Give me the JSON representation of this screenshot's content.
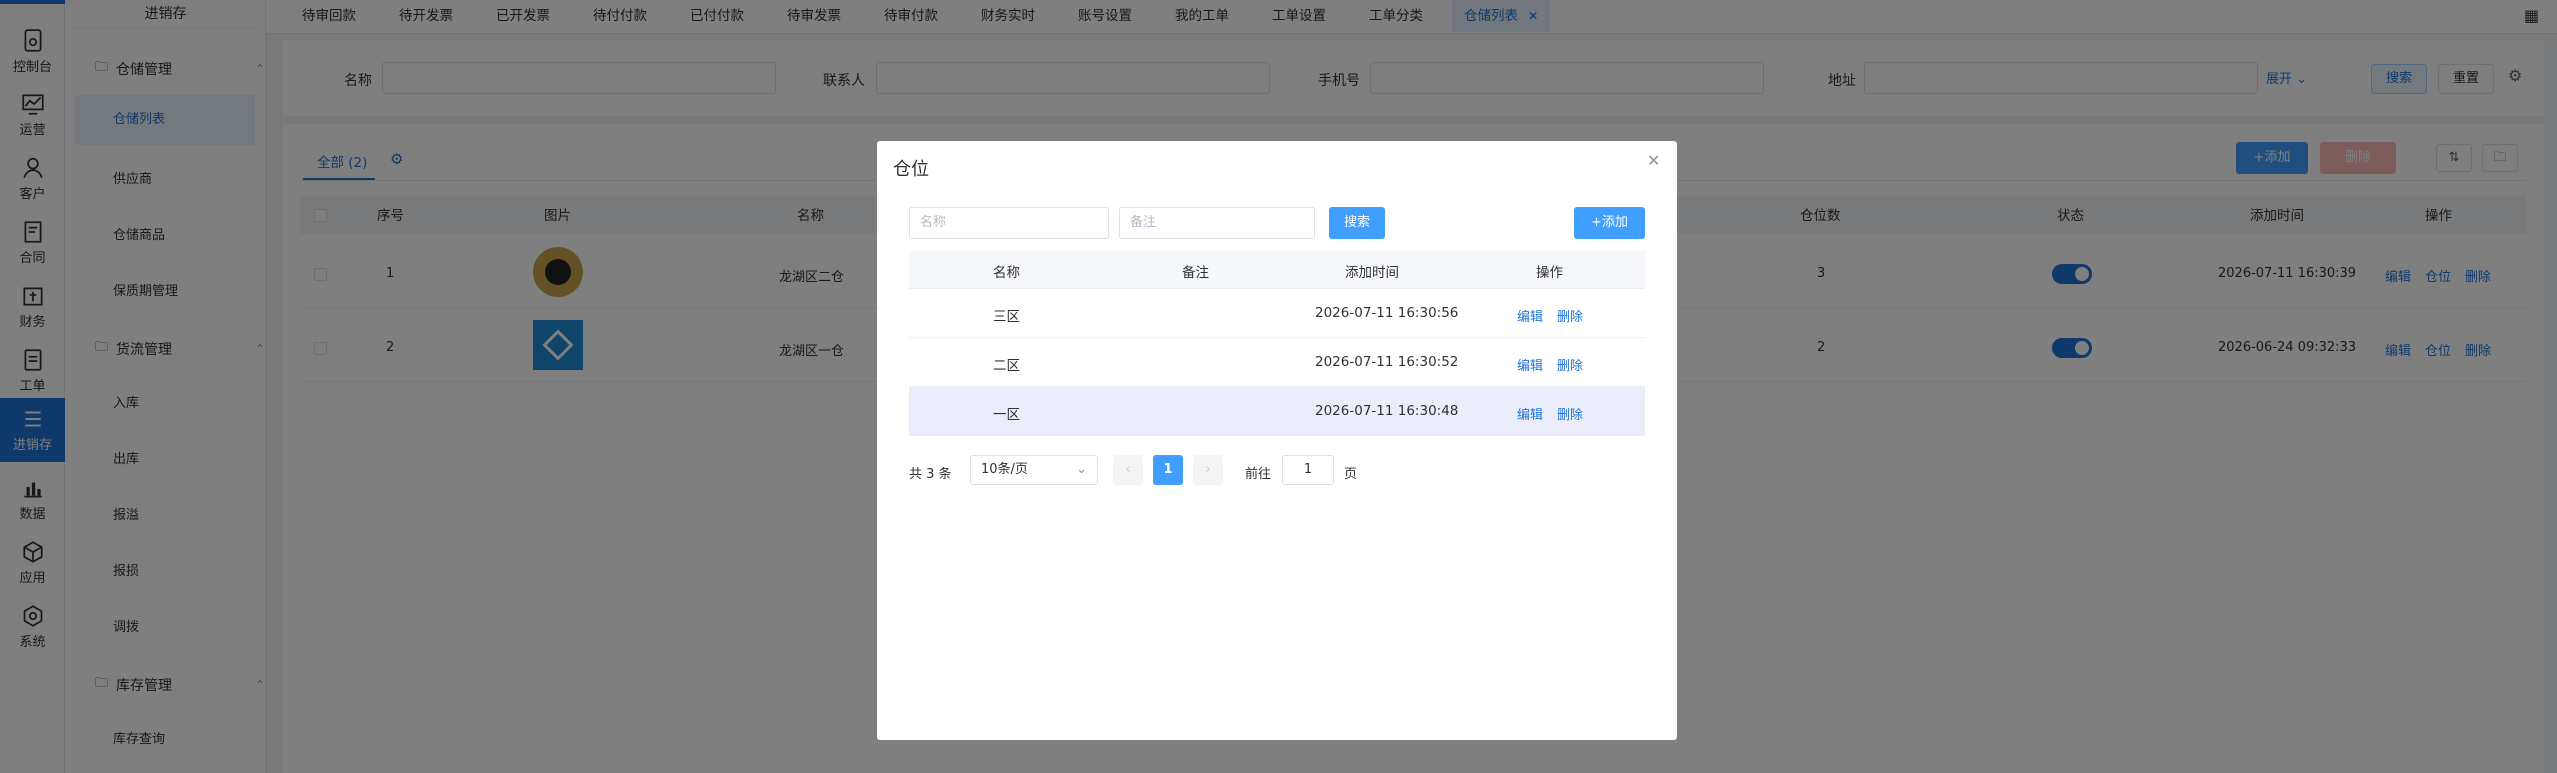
{
  "rail": {
    "items": [
      {
        "label": "控制台",
        "icon": "dashboard-icon"
      },
      {
        "label": "运营",
        "icon": "chart-line-icon"
      },
      {
        "label": "客户",
        "icon": "user-icon"
      },
      {
        "label": "合同",
        "icon": "contract-icon"
      },
      {
        "label": "财务",
        "icon": "finance-icon"
      },
      {
        "label": "工单",
        "icon": "workorder-icon"
      },
      {
        "label": "进销存",
        "icon": "list-icon"
      },
      {
        "label": "数据",
        "icon": "bar-chart-icon"
      },
      {
        "label": "应用",
        "icon": "cube-icon"
      },
      {
        "label": "系统",
        "icon": "settings-icon"
      }
    ],
    "active_index": 6
  },
  "subnav": {
    "title": "进销存",
    "groups": [
      {
        "label": "仓储管理",
        "items": [
          "仓储列表",
          "供应商",
          "仓储商品",
          "保质期管理"
        ]
      },
      {
        "label": "货流管理",
        "items": [
          "入库",
          "出库",
          "报溢",
          "报损",
          "调拨"
        ]
      },
      {
        "label": "库存管理",
        "items": [
          "库存查询"
        ]
      }
    ],
    "active_item": "仓储列表"
  },
  "tabs": [
    "待审回款",
    "待开发票",
    "已开发票",
    "待付付款",
    "已付付款",
    "待审发票",
    "待审付款",
    "财务实时",
    "账号设置",
    "我的工单",
    "工单设置",
    "工单分类",
    "仓储列表"
  ],
  "active_tab": "仓储列表",
  "filter": {
    "name_label": "名称",
    "contact_label": "联系人",
    "phone_label": "手机号",
    "address_label": "地址",
    "expand_label": "展开",
    "search_label": "搜索",
    "reset_label": "重置"
  },
  "table": {
    "tab_all": "全部 (2)",
    "add_label": "+添加",
    "delete_label": "删除",
    "columns": [
      "序号",
      "图片",
      "名称",
      "仓位数",
      "状态",
      "添加时间",
      "操作"
    ],
    "rows": [
      {
        "index": "1",
        "name": "龙湖区二仓",
        "slots": "3",
        "enabled": true,
        "added": "2026-07-11 16:30:39",
        "actions": [
          "编辑",
          "仓位",
          "删除"
        ]
      },
      {
        "index": "2",
        "name": "龙湖区一仓",
        "slots": "2",
        "enabled": true,
        "added": "2026-06-24 09:32:33",
        "actions": [
          "编辑",
          "仓位",
          "删除"
        ]
      }
    ]
  },
  "dialog": {
    "title": "仓位",
    "name_placeholder": "名称",
    "remark_placeholder": "备注",
    "search_label": "搜索",
    "add_label": "+添加",
    "columns": [
      "名称",
      "备注",
      "添加时间",
      "操作"
    ],
    "rows": [
      {
        "name": "三区",
        "remark": "",
        "added": "2026-07-11 16:30:56",
        "edit": "编辑",
        "delete": "删除"
      },
      {
        "name": "二区",
        "remark": "",
        "added": "2026-07-11 16:30:52",
        "edit": "编辑",
        "delete": "删除"
      },
      {
        "name": "一区",
        "remark": "",
        "added": "2026-07-11 16:30:48",
        "edit": "编辑",
        "delete": "删除"
      }
    ],
    "pagination": {
      "total": "共 3 条",
      "page_size": "10条/页",
      "current_page": "1",
      "goto_label": "前往",
      "goto_value": "1",
      "page_unit": "页"
    }
  },
  "colors": {
    "accent": "#1f72d6",
    "button": "#409eff",
    "danger": "#f56c6c"
  }
}
